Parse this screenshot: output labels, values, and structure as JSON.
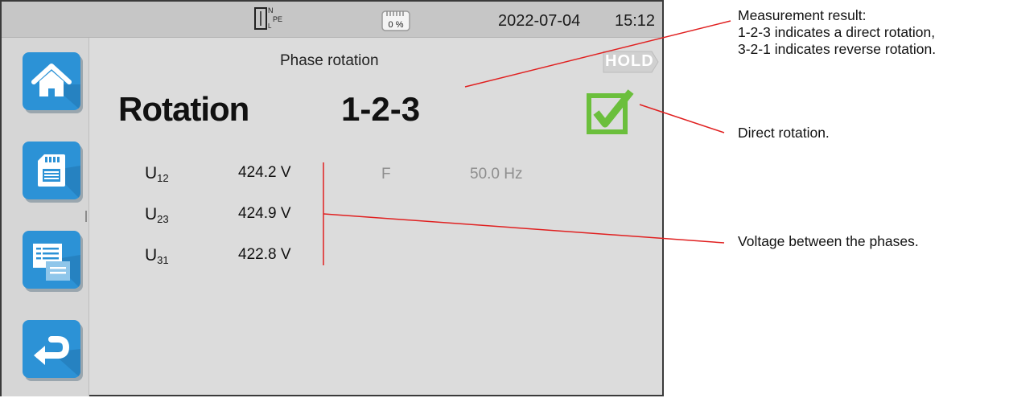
{
  "status_bar": {
    "wiring_labels": {
      "n": "N",
      "l": "L",
      "pe": "PE"
    },
    "battery_percent": "0 %",
    "date": "2022-07-04",
    "time": "15:12"
  },
  "sidebar": {
    "items": [
      {
        "name": "home",
        "icon": "home-icon"
      },
      {
        "name": "memory",
        "icon": "sd-card-icon"
      },
      {
        "name": "recorded-measurements",
        "icon": "documents-icon"
      },
      {
        "name": "back",
        "icon": "return-arrow-icon"
      }
    ]
  },
  "measurement": {
    "title": "Phase rotation",
    "hold_label": "HOLD",
    "rotation_label": "Rotation",
    "rotation_value": "1-2-3",
    "result_icon": "checkbox-checked-icon",
    "result_color": "#6bbf3c",
    "voltages": [
      {
        "symbol": "U",
        "sub": "12",
        "value": "424.2 V"
      },
      {
        "symbol": "U",
        "sub": "23",
        "value": "424.9 V"
      },
      {
        "symbol": "U",
        "sub": "31",
        "value": "422.8 V"
      }
    ],
    "frequency_label": "F",
    "frequency_value": "50.0 Hz"
  },
  "annotations": {
    "measurement_result": [
      "Measurement result:",
      "1-2-3 indicates a direct rotation,",
      "3-2-1 indicates reverse rotation."
    ],
    "direct_rotation": "Direct rotation.",
    "voltage": "Voltage between the phases.",
    "line_color": "#e02020"
  }
}
